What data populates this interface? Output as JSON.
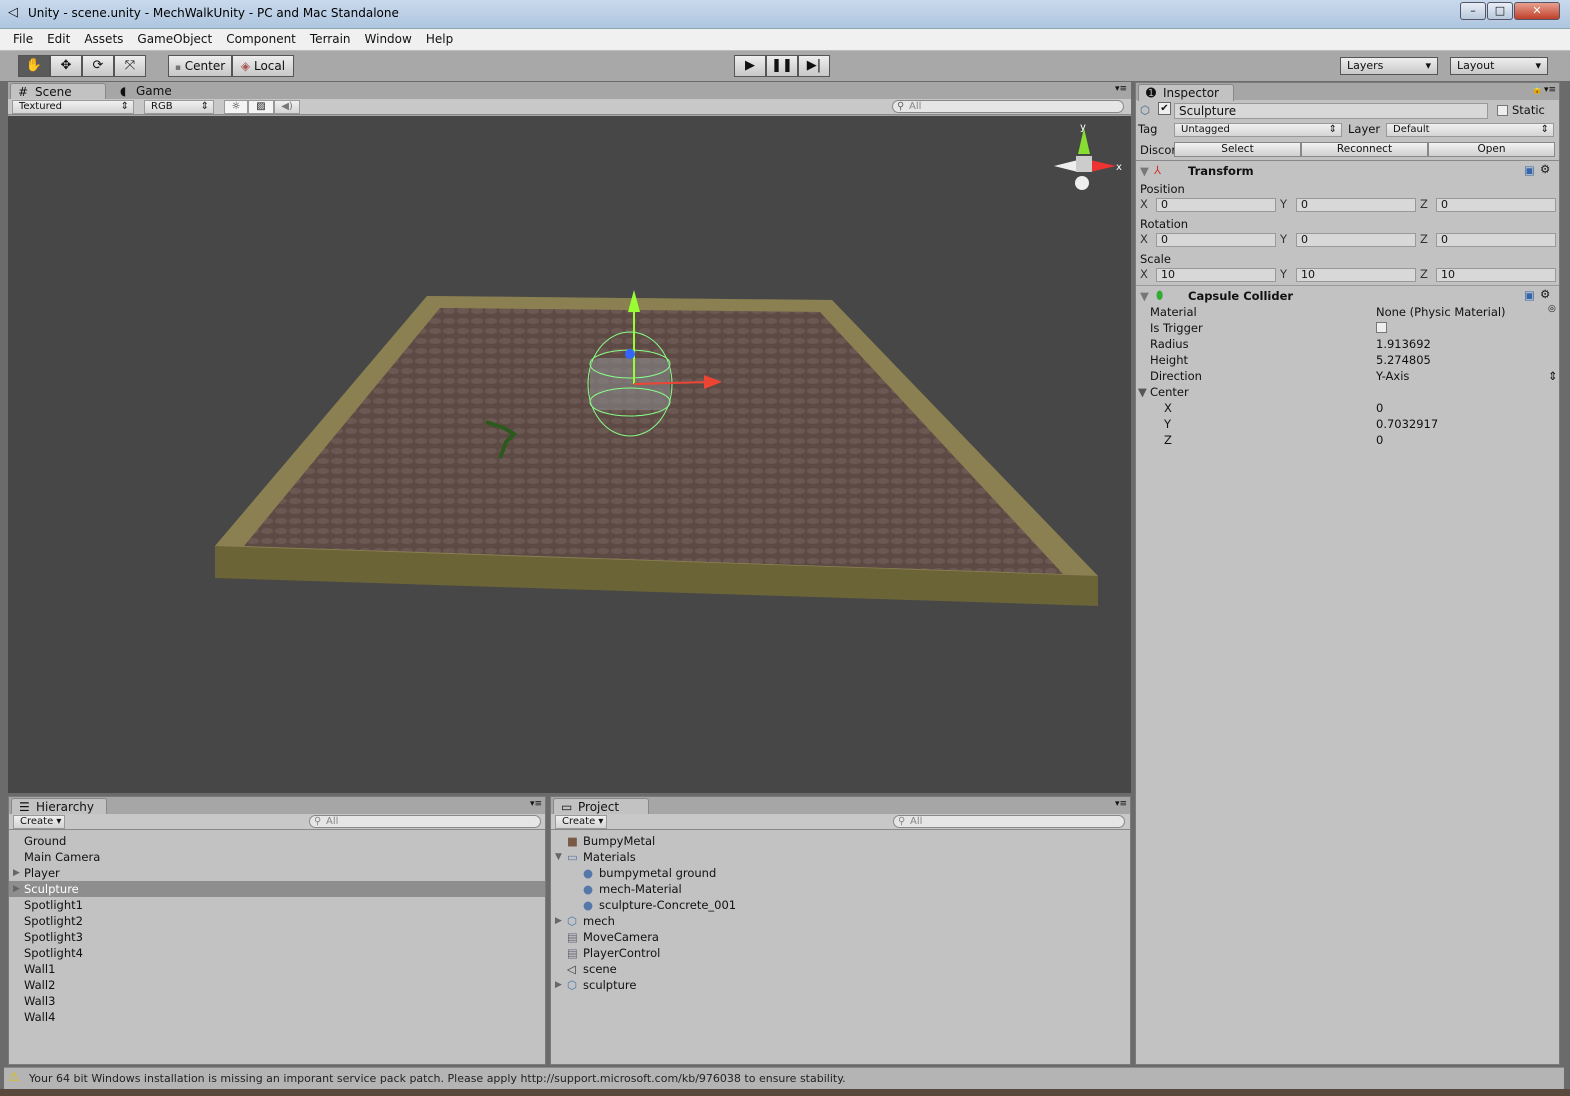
{
  "window": {
    "title": "Unity - scene.unity - MechWalkUnity - PC and Mac Standalone",
    "controls": [
      "minimize",
      "maximize",
      "close"
    ]
  },
  "menu": [
    "File",
    "Edit",
    "Assets",
    "GameObject",
    "Component",
    "Terrain",
    "Window",
    "Help"
  ],
  "toolbar": {
    "tools": [
      "hand-icon",
      "move-icon",
      "rotate-icon",
      "scale-icon"
    ],
    "pivot": "Center",
    "space": "Local",
    "play": "play-icon",
    "pause": "pause-icon",
    "step": "step-icon",
    "layers": "Layers",
    "layout": "Layout"
  },
  "scene": {
    "tab": "Scene",
    "game_tab": "Game",
    "draw_mode": "Textured",
    "render_mode": "RGB",
    "search_placeholder": "All",
    "gizmo": {
      "y": "y",
      "x": "x"
    }
  },
  "inspector": {
    "tab": "Inspector",
    "object_name": "Sculpture",
    "active": true,
    "static_label": "Static",
    "static": false,
    "tag_label": "Tag",
    "tag": "Untagged",
    "layer_label": "Layer",
    "layer": "Default",
    "prefab_label": "Discor",
    "prefab_buttons": [
      "Select",
      "Reconnect",
      "Open"
    ],
    "transform": {
      "title": "Transform",
      "position_label": "Position",
      "rotation_label": "Rotation",
      "scale_label": "Scale",
      "position": {
        "x": "0",
        "y": "0",
        "z": "0"
      },
      "rotation": {
        "x": "0",
        "y": "0",
        "z": "0"
      },
      "scale": {
        "x": "10",
        "y": "10",
        "z": "10"
      }
    },
    "capsule": {
      "title": "Capsule Collider",
      "material_label": "Material",
      "material": "None (Physic Material)",
      "trigger_label": "Is Trigger",
      "is_trigger": false,
      "radius_label": "Radius",
      "radius": "1.913692",
      "height_label": "Height",
      "height": "5.274805",
      "direction_label": "Direction",
      "direction": "Y-Axis",
      "center_label": "Center",
      "center": {
        "x": "0",
        "y": "0.7032917",
        "z": "0"
      }
    },
    "axis": {
      "x": "X",
      "y": "Y",
      "z": "Z"
    }
  },
  "hierarchy": {
    "tab": "Hierarchy",
    "create": "Create",
    "search_placeholder": "All",
    "selected": "Sculpture",
    "items": [
      "Ground",
      "Main Camera",
      "Player",
      "Sculpture",
      "Spotlight1",
      "Spotlight2",
      "Spotlight3",
      "Spotlight4",
      "Wall1",
      "Wall2",
      "Wall3",
      "Wall4"
    ]
  },
  "project": {
    "tab": "Project",
    "create": "Create",
    "search_placeholder": "All",
    "items": [
      {
        "name": "BumpyMetal",
        "icon": "texture-icon"
      },
      {
        "name": "Materials",
        "icon": "folder-icon"
      },
      {
        "name": "bumpymetal ground",
        "icon": "material-icon"
      },
      {
        "name": "mech-Material",
        "icon": "material-icon"
      },
      {
        "name": "sculpture-Concrete_001",
        "icon": "material-icon"
      },
      {
        "name": "mech",
        "icon": "prefab-icon"
      },
      {
        "name": "MoveCamera",
        "icon": "script-icon"
      },
      {
        "name": "PlayerControl",
        "icon": "script-icon"
      },
      {
        "name": "scene",
        "icon": "unity-scene-icon"
      },
      {
        "name": "sculpture",
        "icon": "prefab-icon"
      }
    ]
  },
  "status": {
    "message": "Your 64 bit Windows installation is missing an imporant service pack patch. Please apply http://support.microsoft.com/kb/976038 to ensure stability."
  }
}
